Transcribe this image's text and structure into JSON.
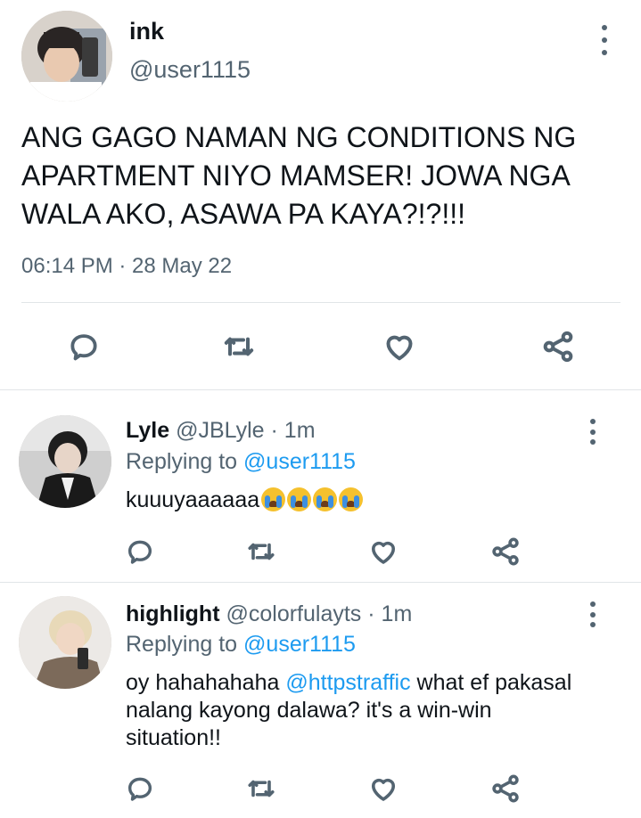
{
  "main_tweet": {
    "name": "ink",
    "handle": "@user1115",
    "text": "ANG GAGO NAMAN NG CONDITIONS NG APARTMENT NIYO MAMSER! JOWA NGA WALA AKO, ASAWA PA KAYA?!?!!!",
    "timestamp": "06:14 PM · 28 May 22",
    "actions": [
      "reply-icon",
      "retweet-icon",
      "like-icon",
      "share-icon"
    ]
  },
  "replies": [
    {
      "name": "Lyle",
      "handle": "@JBLyle",
      "time": "· 1m",
      "replying_prefix": "Replying to ",
      "replying_to": "@user1115",
      "text": "kuuuyaaaaaa",
      "emoji_count": 4,
      "emoji": "loudly-crying-face"
    },
    {
      "name": "highlight",
      "handle": "@colorfulayts",
      "time": "· 1m",
      "replying_prefix": "Replying to ",
      "replying_to": "@user1115",
      "text_before": "oy hahahahaha ",
      "mention": "@httpstraffic",
      "text_after": " what ef pakasal nalang kayong dalawa? it's a win-win situation!!"
    }
  ],
  "colors": {
    "text": "#0f1419",
    "secondary": "#536471",
    "accent": "#1d9bf0",
    "divider": "#e1e5e8"
  }
}
